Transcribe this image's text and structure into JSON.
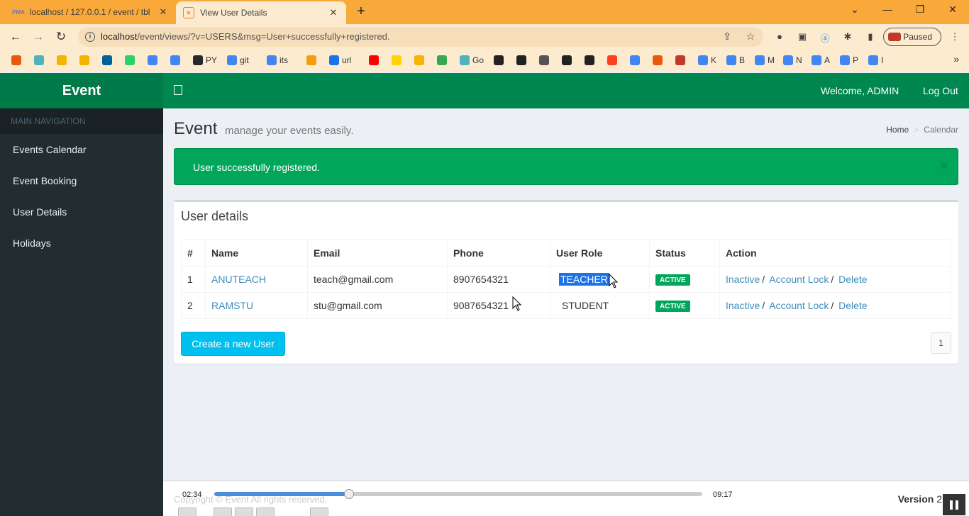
{
  "browser": {
    "tabs": [
      {
        "title": "localhost / 127.0.0.1 / event / tbl",
        "favicon": "PMA",
        "active": false
      },
      {
        "title": "View User Details",
        "favicon": "xampp-icon",
        "active": true
      }
    ],
    "new_tab": "+",
    "url_host": "localhost",
    "url_path": "/event/views/?v=USERS&msg=User+successfully+registered.",
    "profile_status": "Paused",
    "bookmarks": [
      {
        "label": "",
        "color": "#e8590c"
      },
      {
        "label": "",
        "color": "#4fb3bf"
      },
      {
        "label": "",
        "color": "#f4b400"
      },
      {
        "label": "",
        "color": "#f4b400"
      },
      {
        "label": "",
        "color": "#00629b"
      },
      {
        "label": "",
        "color": "#25d366"
      },
      {
        "label": "",
        "color": "#4285f4"
      },
      {
        "label": "",
        "color": "#4285f4"
      },
      {
        "label": "PY",
        "color": "#24292e"
      },
      {
        "label": "git",
        "color": "#4285f4"
      },
      {
        "label": "its",
        "color": "#4285f4"
      },
      {
        "label": "",
        "color": "#f89c0e"
      },
      {
        "label": "url",
        "color": "#1a73e8"
      },
      {
        "label": "",
        "color": "#ff0000"
      },
      {
        "label": "",
        "color": "#ffd400"
      },
      {
        "label": "",
        "color": "#f4b400"
      },
      {
        "label": "",
        "color": "#34a853"
      },
      {
        "label": "Go",
        "color": "#4fb3bf"
      },
      {
        "label": "",
        "color": "#222222"
      },
      {
        "label": "",
        "color": "#222222"
      },
      {
        "label": "",
        "color": "#555555"
      },
      {
        "label": "",
        "color": "#222222"
      },
      {
        "label": "",
        "color": "#222222"
      },
      {
        "label": "",
        "color": "#fc3f1d"
      },
      {
        "label": "",
        "color": "#4285f4"
      },
      {
        "label": "",
        "color": "#e8590c"
      },
      {
        "label": "",
        "color": "#c0392b"
      },
      {
        "label": "K",
        "color": "#4285f4"
      },
      {
        "label": "B",
        "color": "#4285f4"
      },
      {
        "label": "M",
        "color": "#4285f4"
      },
      {
        "label": "N",
        "color": "#4285f4"
      },
      {
        "label": "A",
        "color": "#4285f4"
      },
      {
        "label": "P",
        "color": "#4285f4"
      },
      {
        "label": "I",
        "color": "#4285f4"
      }
    ],
    "bookmarks_more": "»"
  },
  "app": {
    "logo": "Event",
    "welcome": "Welcome, ADMIN",
    "logout": "Log Out",
    "nav_header": "MAIN NAVIGATION",
    "nav_items": [
      "Events Calendar",
      "Event Booking",
      "User Details",
      "Holidays"
    ],
    "page_title": "Event",
    "page_subtitle": "manage your events easily.",
    "breadcrumb": {
      "home": "Home",
      "sep": ">",
      "current": "Calendar"
    },
    "alert_message": "User successfully registered.",
    "alert_close": "×",
    "box_title": "User details",
    "table": {
      "headers": [
        "#",
        "Name",
        "Email",
        "Phone",
        "User Role",
        "Status",
        "Action"
      ],
      "rows": [
        {
          "num": "1",
          "name": "ANUTEACH",
          "email": "teach@gmail.com",
          "phone": "8907654321",
          "role": "TEACHER",
          "status": "ACTIVE",
          "actions": [
            "Inactive",
            "Account Lock",
            "Delete"
          ]
        },
        {
          "num": "2",
          "name": "RAMSTU",
          "email": "stu@gmail.com",
          "phone": "9087654321",
          "role": "STUDENT",
          "status": "ACTIVE",
          "actions": [
            "Inactive",
            "Account Lock",
            "Delete"
          ]
        }
      ]
    },
    "create_button": "Create a new User",
    "pagination": [
      "1"
    ],
    "copyright": "Copyright © Event All rights reserved.",
    "version_label": "Version",
    "version_value": "2"
  },
  "media_player": {
    "current_time": "02:34",
    "total_time": "09:17",
    "progress_fraction": 0.276
  }
}
